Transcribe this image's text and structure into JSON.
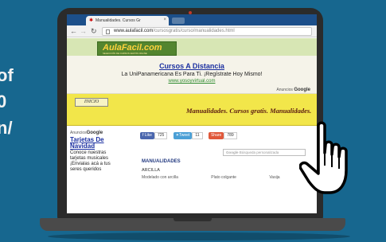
{
  "side_text": [
    "of",
    "0",
    "n/"
  ],
  "browser": {
    "tab_title": "Manualidades. Cursos Gr",
    "tab_close": "×",
    "url_host": "www.aulafacil.com",
    "url_path": "/cursosgratis/curso/manualidades.html"
  },
  "page": {
    "logo_text": "AulaFacil.com",
    "logo_sub": "SELECCIÓN DE CURSOS GRATIS ONLINE",
    "ad": {
      "title": "Cursos A Distancia",
      "subtitle": "La UniPanamericana Es Para Ti. ¡Regístrate Hoy Mismo!",
      "url": "www.yosoyvirtual.com",
      "anuncios": "Anuncios",
      "google": "Google"
    },
    "nav": {
      "inicio": "INICIO",
      "marquee": "Manualidades. Cursos gratis. Manualidades."
    },
    "left_ad": {
      "anuncios": "Anuncios",
      "google": "Google",
      "title": "Tarjetas De Navidad",
      "text": "Conoce nuestras tarjetas musicales ¡Envialas acá a tus seres queridos"
    },
    "social": {
      "like_label": "Like",
      "like_count": "725",
      "tweet_label": "Tweet",
      "tweet_count": "11",
      "share_label": "Share",
      "share_count": "789"
    },
    "search_placeholder": "Búsqueda personalizada",
    "search_google": "Google",
    "section_title": "MANUALIDADES",
    "first_item": "ARCILLA",
    "row_items": [
      "Modelado con arcilla",
      "Plato colgante",
      "Vasija"
    ]
  }
}
